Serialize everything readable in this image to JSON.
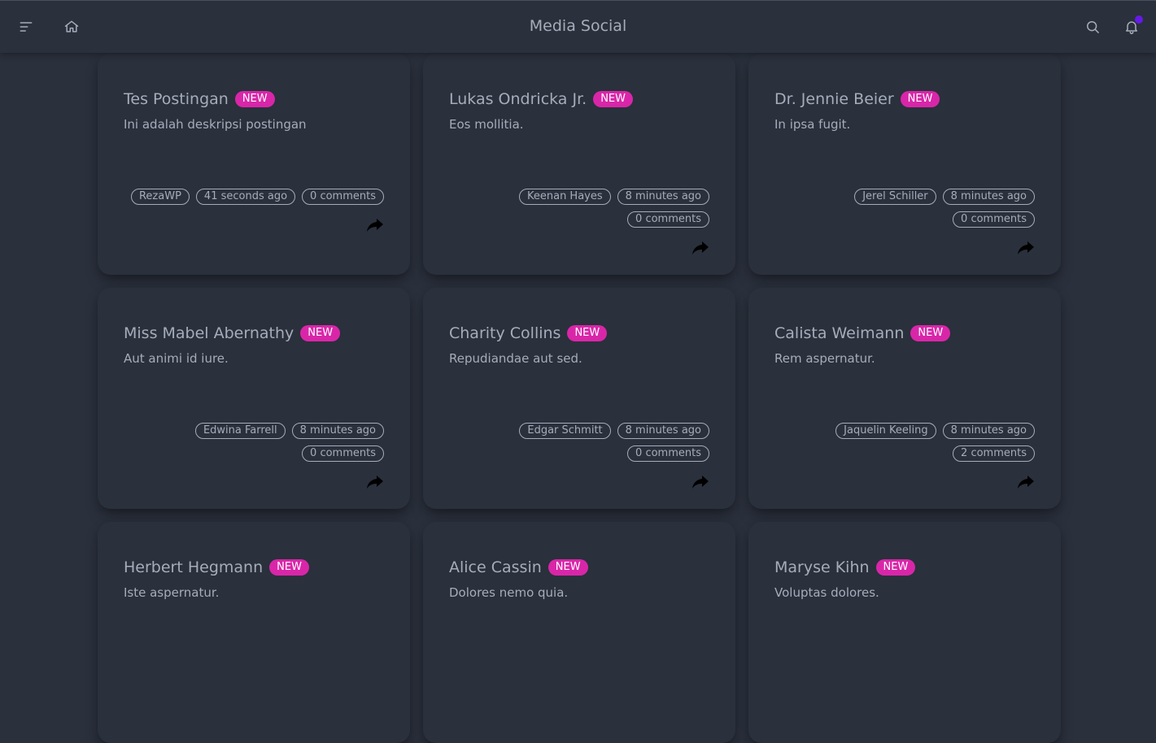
{
  "header": {
    "title": "Media Social"
  },
  "badge_label": "NEW",
  "colors": {
    "background": "#2a303c",
    "text": "#a6adba",
    "badge": "#d926a9",
    "notification_dot": "#661ae6"
  },
  "posts": [
    {
      "title": "Tes Postingan",
      "description": "Ini adalah deskripsi postingan",
      "author": "RezaWP",
      "time": "41 seconds ago",
      "comments": "0 comments"
    },
    {
      "title": "Lukas Ondricka Jr.",
      "description": "Eos mollitia.",
      "author": "Keenan Hayes",
      "time": "8 minutes ago",
      "comments": "0 comments"
    },
    {
      "title": "Dr. Jennie Beier",
      "description": "In ipsa fugit.",
      "author": "Jerel Schiller",
      "time": "8 minutes ago",
      "comments": "0 comments"
    },
    {
      "title": "Miss Mabel Abernathy",
      "description": "Aut animi id iure.",
      "author": "Edwina Farrell",
      "time": "8 minutes ago",
      "comments": "0 comments"
    },
    {
      "title": "Charity Collins",
      "description": "Repudiandae aut sed.",
      "author": "Edgar Schmitt",
      "time": "8 minutes ago",
      "comments": "0 comments"
    },
    {
      "title": "Calista Weimann",
      "description": "Rem aspernatur.",
      "author": "Jaquelin Keeling",
      "time": "8 minutes ago",
      "comments": "2 comments"
    },
    {
      "title": "Herbert Hegmann",
      "description": "Iste aspernatur.",
      "author": "",
      "time": "",
      "comments": ""
    },
    {
      "title": "Alice Cassin",
      "description": "Dolores nemo quia.",
      "author": "",
      "time": "",
      "comments": ""
    },
    {
      "title": "Maryse Kihn",
      "description": "Voluptas dolores.",
      "author": "",
      "time": "",
      "comments": ""
    }
  ]
}
